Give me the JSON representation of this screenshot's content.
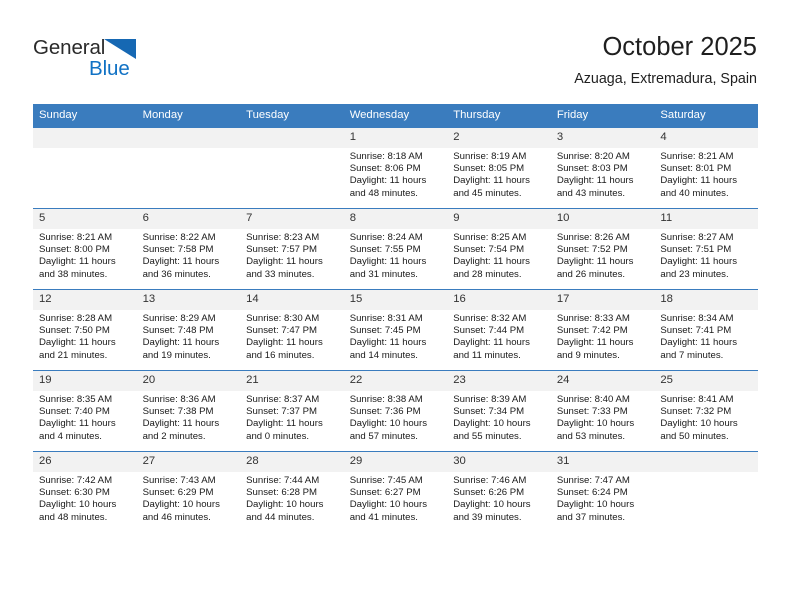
{
  "brand": {
    "name_part1": "General",
    "name_part2": "Blue",
    "triangle_color": "#1668b3",
    "blue_color": "#1071c4"
  },
  "header": {
    "title": "October 2025",
    "subtitle": "Azuaga, Extremadura, Spain"
  },
  "calendar": {
    "header_bg": "#3a7cbe",
    "daynum_bg": "#f2f2f2",
    "weekdays": [
      "Sunday",
      "Monday",
      "Tuesday",
      "Wednesday",
      "Thursday",
      "Friday",
      "Saturday"
    ],
    "weeks": [
      [
        {
          "day": "",
          "empty": true
        },
        {
          "day": "",
          "empty": true
        },
        {
          "day": "",
          "empty": true
        },
        {
          "day": "1",
          "sunrise": "Sunrise: 8:18 AM",
          "sunset": "Sunset: 8:06 PM",
          "daylight1": "Daylight: 11 hours",
          "daylight2": "and 48 minutes."
        },
        {
          "day": "2",
          "sunrise": "Sunrise: 8:19 AM",
          "sunset": "Sunset: 8:05 PM",
          "daylight1": "Daylight: 11 hours",
          "daylight2": "and 45 minutes."
        },
        {
          "day": "3",
          "sunrise": "Sunrise: 8:20 AM",
          "sunset": "Sunset: 8:03 PM",
          "daylight1": "Daylight: 11 hours",
          "daylight2": "and 43 minutes."
        },
        {
          "day": "4",
          "sunrise": "Sunrise: 8:21 AM",
          "sunset": "Sunset: 8:01 PM",
          "daylight1": "Daylight: 11 hours",
          "daylight2": "and 40 minutes."
        }
      ],
      [
        {
          "day": "5",
          "sunrise": "Sunrise: 8:21 AM",
          "sunset": "Sunset: 8:00 PM",
          "daylight1": "Daylight: 11 hours",
          "daylight2": "and 38 minutes."
        },
        {
          "day": "6",
          "sunrise": "Sunrise: 8:22 AM",
          "sunset": "Sunset: 7:58 PM",
          "daylight1": "Daylight: 11 hours",
          "daylight2": "and 36 minutes."
        },
        {
          "day": "7",
          "sunrise": "Sunrise: 8:23 AM",
          "sunset": "Sunset: 7:57 PM",
          "daylight1": "Daylight: 11 hours",
          "daylight2": "and 33 minutes."
        },
        {
          "day": "8",
          "sunrise": "Sunrise: 8:24 AM",
          "sunset": "Sunset: 7:55 PM",
          "daylight1": "Daylight: 11 hours",
          "daylight2": "and 31 minutes."
        },
        {
          "day": "9",
          "sunrise": "Sunrise: 8:25 AM",
          "sunset": "Sunset: 7:54 PM",
          "daylight1": "Daylight: 11 hours",
          "daylight2": "and 28 minutes."
        },
        {
          "day": "10",
          "sunrise": "Sunrise: 8:26 AM",
          "sunset": "Sunset: 7:52 PM",
          "daylight1": "Daylight: 11 hours",
          "daylight2": "and 26 minutes."
        },
        {
          "day": "11",
          "sunrise": "Sunrise: 8:27 AM",
          "sunset": "Sunset: 7:51 PM",
          "daylight1": "Daylight: 11 hours",
          "daylight2": "and 23 minutes."
        }
      ],
      [
        {
          "day": "12",
          "sunrise": "Sunrise: 8:28 AM",
          "sunset": "Sunset: 7:50 PM",
          "daylight1": "Daylight: 11 hours",
          "daylight2": "and 21 minutes."
        },
        {
          "day": "13",
          "sunrise": "Sunrise: 8:29 AM",
          "sunset": "Sunset: 7:48 PM",
          "daylight1": "Daylight: 11 hours",
          "daylight2": "and 19 minutes."
        },
        {
          "day": "14",
          "sunrise": "Sunrise: 8:30 AM",
          "sunset": "Sunset: 7:47 PM",
          "daylight1": "Daylight: 11 hours",
          "daylight2": "and 16 minutes."
        },
        {
          "day": "15",
          "sunrise": "Sunrise: 8:31 AM",
          "sunset": "Sunset: 7:45 PM",
          "daylight1": "Daylight: 11 hours",
          "daylight2": "and 14 minutes."
        },
        {
          "day": "16",
          "sunrise": "Sunrise: 8:32 AM",
          "sunset": "Sunset: 7:44 PM",
          "daylight1": "Daylight: 11 hours",
          "daylight2": "and 11 minutes."
        },
        {
          "day": "17",
          "sunrise": "Sunrise: 8:33 AM",
          "sunset": "Sunset: 7:42 PM",
          "daylight1": "Daylight: 11 hours",
          "daylight2": "and 9 minutes."
        },
        {
          "day": "18",
          "sunrise": "Sunrise: 8:34 AM",
          "sunset": "Sunset: 7:41 PM",
          "daylight1": "Daylight: 11 hours",
          "daylight2": "and 7 minutes."
        }
      ],
      [
        {
          "day": "19",
          "sunrise": "Sunrise: 8:35 AM",
          "sunset": "Sunset: 7:40 PM",
          "daylight1": "Daylight: 11 hours",
          "daylight2": "and 4 minutes."
        },
        {
          "day": "20",
          "sunrise": "Sunrise: 8:36 AM",
          "sunset": "Sunset: 7:38 PM",
          "daylight1": "Daylight: 11 hours",
          "daylight2": "and 2 minutes."
        },
        {
          "day": "21",
          "sunrise": "Sunrise: 8:37 AM",
          "sunset": "Sunset: 7:37 PM",
          "daylight1": "Daylight: 11 hours",
          "daylight2": "and 0 minutes."
        },
        {
          "day": "22",
          "sunrise": "Sunrise: 8:38 AM",
          "sunset": "Sunset: 7:36 PM",
          "daylight1": "Daylight: 10 hours",
          "daylight2": "and 57 minutes."
        },
        {
          "day": "23",
          "sunrise": "Sunrise: 8:39 AM",
          "sunset": "Sunset: 7:34 PM",
          "daylight1": "Daylight: 10 hours",
          "daylight2": "and 55 minutes."
        },
        {
          "day": "24",
          "sunrise": "Sunrise: 8:40 AM",
          "sunset": "Sunset: 7:33 PM",
          "daylight1": "Daylight: 10 hours",
          "daylight2": "and 53 minutes."
        },
        {
          "day": "25",
          "sunrise": "Sunrise: 8:41 AM",
          "sunset": "Sunset: 7:32 PM",
          "daylight1": "Daylight: 10 hours",
          "daylight2": "and 50 minutes."
        }
      ],
      [
        {
          "day": "26",
          "sunrise": "Sunrise: 7:42 AM",
          "sunset": "Sunset: 6:30 PM",
          "daylight1": "Daylight: 10 hours",
          "daylight2": "and 48 minutes."
        },
        {
          "day": "27",
          "sunrise": "Sunrise: 7:43 AM",
          "sunset": "Sunset: 6:29 PM",
          "daylight1": "Daylight: 10 hours",
          "daylight2": "and 46 minutes."
        },
        {
          "day": "28",
          "sunrise": "Sunrise: 7:44 AM",
          "sunset": "Sunset: 6:28 PM",
          "daylight1": "Daylight: 10 hours",
          "daylight2": "and 44 minutes."
        },
        {
          "day": "29",
          "sunrise": "Sunrise: 7:45 AM",
          "sunset": "Sunset: 6:27 PM",
          "daylight1": "Daylight: 10 hours",
          "daylight2": "and 41 minutes."
        },
        {
          "day": "30",
          "sunrise": "Sunrise: 7:46 AM",
          "sunset": "Sunset: 6:26 PM",
          "daylight1": "Daylight: 10 hours",
          "daylight2": "and 39 minutes."
        },
        {
          "day": "31",
          "sunrise": "Sunrise: 7:47 AM",
          "sunset": "Sunset: 6:24 PM",
          "daylight1": "Daylight: 10 hours",
          "daylight2": "and 37 minutes."
        },
        {
          "day": "",
          "empty": true
        }
      ]
    ]
  }
}
